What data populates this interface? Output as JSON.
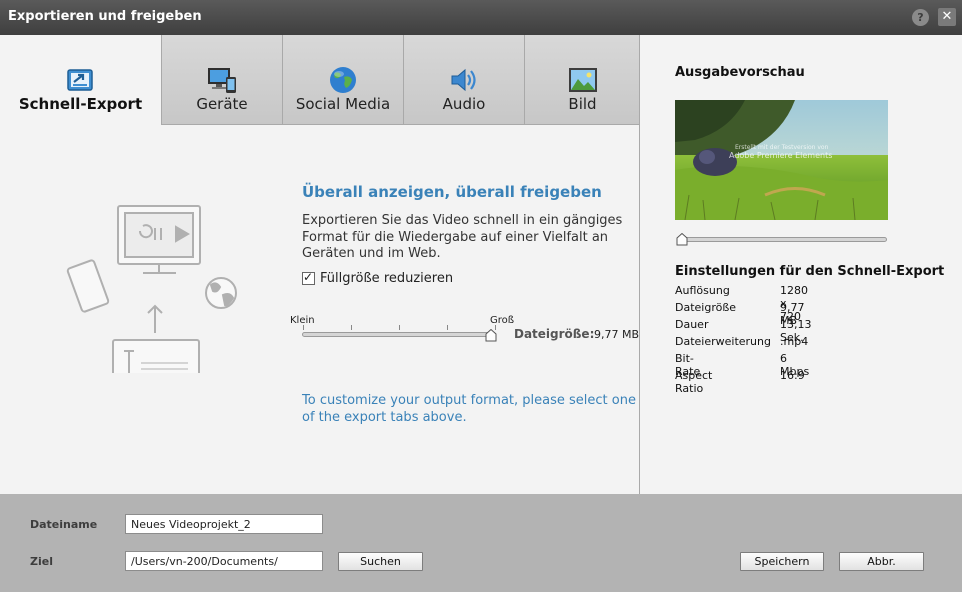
{
  "window": {
    "title": "Exportieren und freigeben",
    "help": "?",
    "close": "✕"
  },
  "tabs": [
    {
      "label": "Schnell-Export",
      "icon": "quick-export-icon",
      "active": true
    },
    {
      "label": "Geräte",
      "icon": "devices-icon"
    },
    {
      "label": "Social Media",
      "icon": "globe-icon"
    },
    {
      "label": "Audio",
      "icon": "speaker-icon"
    },
    {
      "label": "Bild",
      "icon": "picture-icon"
    }
  ],
  "main": {
    "headline": "Überall anzeigen, überall freigeben",
    "description": "Exportieren Sie das Video schnell in ein gängiges Format für die Wiedergabe auf einer Vielfalt an Geräten und im Web.",
    "checkbox_label": "Füllgröße reduzieren",
    "checkbox_checked": true,
    "slider": {
      "min_label": "Klein",
      "max_label": "Groß",
      "value_fraction": 1.0
    },
    "size_label": "Dateigröße:",
    "size_value": "9,77 MB",
    "custom_note": "To customize your output format, please select one of the export tabs above."
  },
  "side": {
    "preview_title": "Ausgabevorschau",
    "preview_watermark_1": "Erstellt mit der Testversion von",
    "preview_watermark_2": "Adobe Premiere Elements",
    "preview_position_fraction": 0.0,
    "settings_title": "Einstellungen für den Schnell-Export",
    "settings": [
      {
        "k": "Auflösung",
        "v": "1280 x 720"
      },
      {
        "k": "Dateigröße",
        "v": "9,77 MB"
      },
      {
        "k": "Dauer",
        "v": "13,13 Sek."
      },
      {
        "k": "Dateierweiterung",
        "v": ".mp4"
      },
      {
        "k": "Bit-Rate",
        "v": "6 Mbps"
      },
      {
        "k": "Aspect Ratio",
        "v": "16:9"
      }
    ]
  },
  "footer": {
    "filename_label": "Dateiname",
    "filename_value": "Neues Videoprojekt_2",
    "target_label": "Ziel",
    "target_value": "/Users/vn-200/Documents/",
    "browse": "Suchen",
    "save": "Speichern",
    "cancel": "Abbr."
  },
  "colors": {
    "accent": "#3a82b8",
    "titlebar": "#4a4a4a",
    "panel": "#f3f3f3",
    "footer": "#b3b3b3"
  }
}
